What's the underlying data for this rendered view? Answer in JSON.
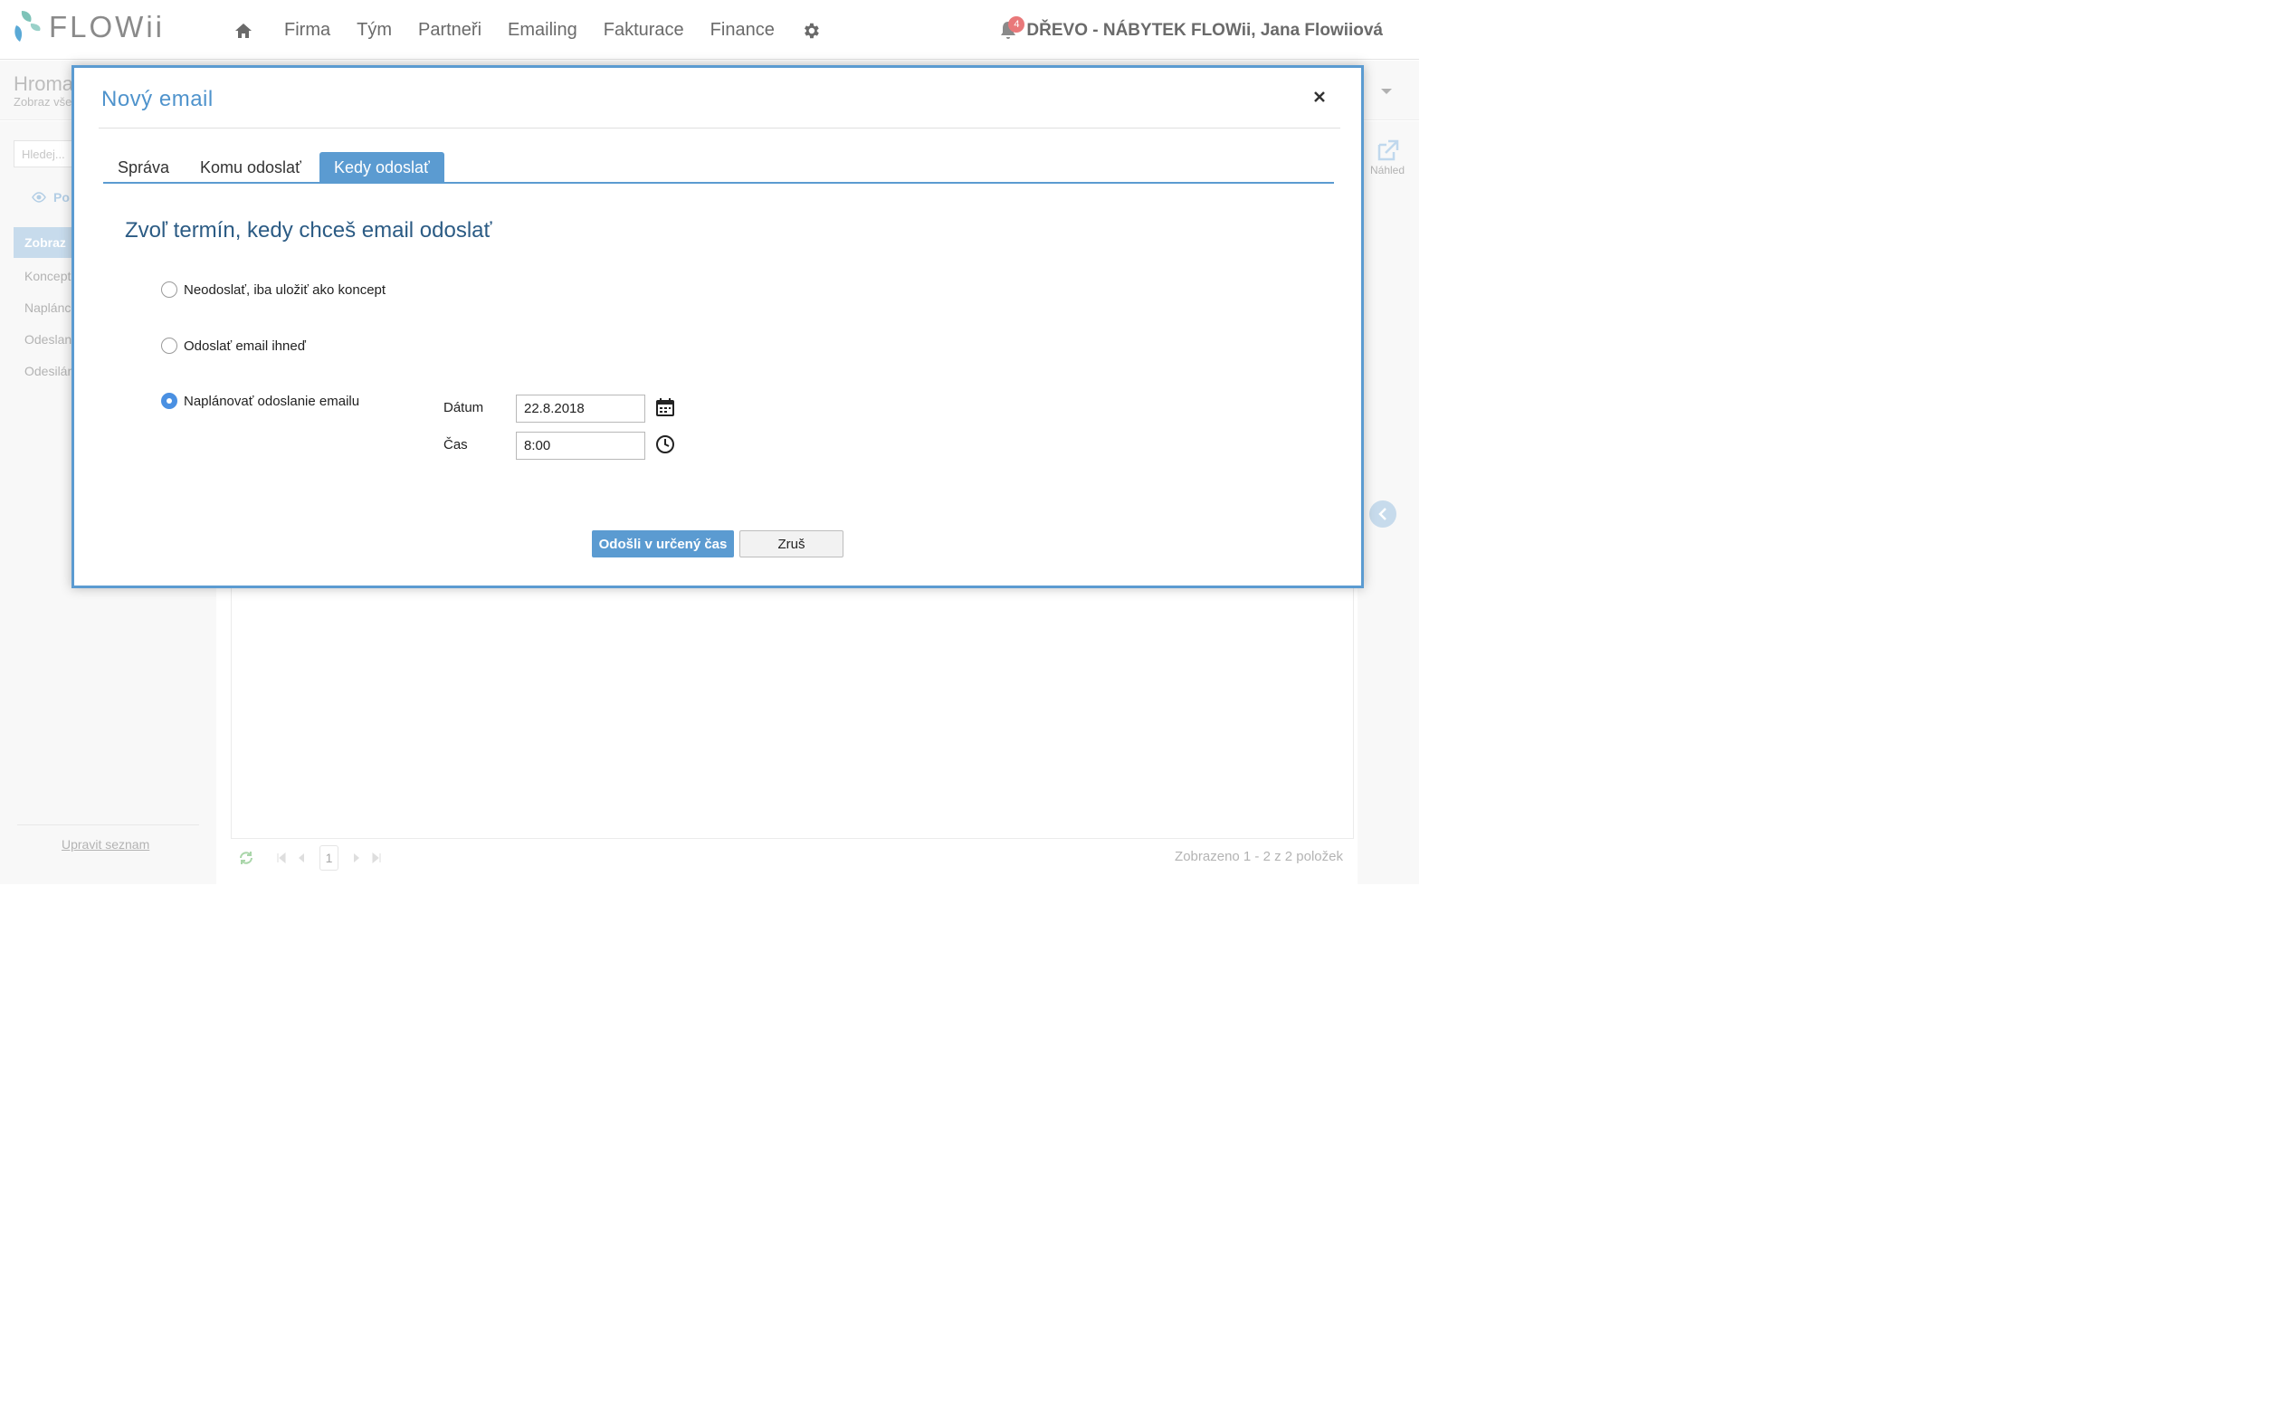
{
  "app": {
    "logo_text": "FLOWii"
  },
  "nav": {
    "items": [
      "Firma",
      "Tým",
      "Partneři",
      "Emailing",
      "Fakturace",
      "Finance"
    ],
    "notification_count": "4",
    "user": "DŘEVO - NÁBYTEK FLOWii, Jana Flowiiová"
  },
  "page": {
    "title": "Hroma",
    "subtitle": "Zobraz vše",
    "search_placeholder": "Hledej...",
    "section_label": "Po",
    "active_filter": "Zobraz",
    "filters": [
      "Koncept",
      "Naplánc",
      "Odeslan",
      "Odesilán"
    ],
    "edit_list": "Upravit seznam",
    "preview_label": "Náhled",
    "pager": {
      "page": "1",
      "info": "Zobrazeno 1 - 2 z 2 položek"
    }
  },
  "modal": {
    "title": "Nový email",
    "tabs": [
      {
        "label": "Správa",
        "active": false
      },
      {
        "label": "Komu odoslať",
        "active": false
      },
      {
        "label": "Kedy odoslať",
        "active": true
      }
    ],
    "heading": "Zvoľ termín, kedy chceš email odoslať",
    "options": [
      {
        "label": "Neodoslať, iba uložiť ako koncept",
        "checked": false
      },
      {
        "label": "Odoslať email ihneď",
        "checked": false
      },
      {
        "label": "Naplánovať odoslanie emailu",
        "checked": true
      }
    ],
    "date_label": "Dátum",
    "date_value": "22.8.2018",
    "time_label": "Čas",
    "time_value": "8:00",
    "submit_label": "Odošli v určený čas",
    "cancel_label": "Zruš"
  },
  "colors": {
    "accent": "#5b9bd1",
    "heading": "#2b5b84",
    "badge": "#e9787a"
  }
}
